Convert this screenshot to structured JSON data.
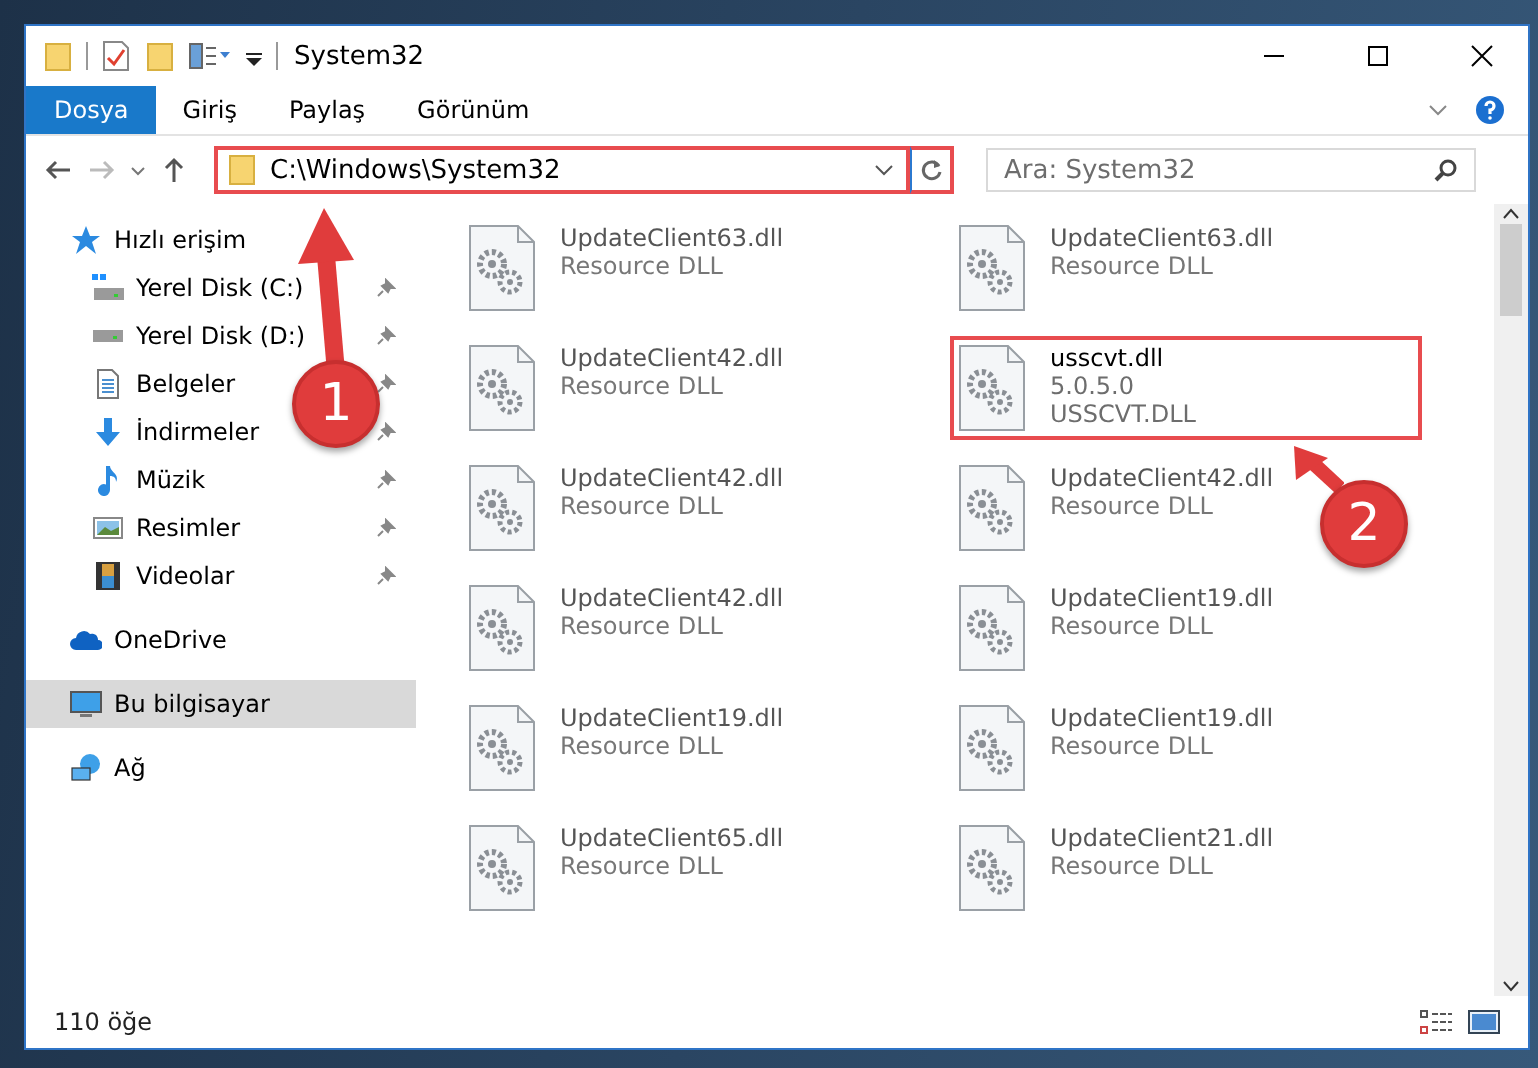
{
  "window": {
    "title": "System32"
  },
  "ribbon_tabs": [
    {
      "label": "Dosya",
      "selected": true
    },
    {
      "label": "Giriş",
      "selected": false
    },
    {
      "label": "Paylaş",
      "selected": false
    },
    {
      "label": "Görünüm",
      "selected": false
    }
  ],
  "address": {
    "value": "C:\\Windows\\System32",
    "highlighted": true
  },
  "search": {
    "placeholder": "Ara: System32"
  },
  "sidebar": [
    {
      "label": "Hızlı erişim",
      "kind": "star",
      "selected": false,
      "children": [
        {
          "label": "Yerel Disk (C:)",
          "kind": "system-drive",
          "pinned": true,
          "selected": false
        },
        {
          "label": "Yerel Disk (D:)",
          "kind": "drive",
          "pinned": true,
          "selected": false
        },
        {
          "label": "Belgeler",
          "kind": "document",
          "pinned": true,
          "selected": false
        },
        {
          "label": "İndirmeler",
          "kind": "download",
          "pinned": true,
          "selected": false
        },
        {
          "label": "Müzik",
          "kind": "music",
          "pinned": true,
          "selected": false
        },
        {
          "label": "Resimler",
          "kind": "pictures",
          "pinned": true,
          "selected": false
        },
        {
          "label": "Videolar",
          "kind": "video",
          "pinned": true,
          "selected": false
        }
      ]
    },
    {
      "label": "OneDrive",
      "kind": "cloud",
      "selected": false
    },
    {
      "label": "Bu bilgisayar",
      "kind": "computer",
      "selected": true
    },
    {
      "label": "Ağ",
      "kind": "network",
      "selected": false
    }
  ],
  "files": [
    {
      "name": "UpdateClient63.dll",
      "lines": [
        "Resource DLL"
      ],
      "blurred": true,
      "highlighted": false
    },
    {
      "name": "UpdateClient63.dll",
      "lines": [
        "Resource DLL"
      ],
      "blurred": true,
      "highlighted": false
    },
    {
      "name": "UpdateClient42.dll",
      "lines": [
        "Resource DLL"
      ],
      "blurred": true,
      "highlighted": false
    },
    {
      "name": "usscvt.dll",
      "lines": [
        "5.0.5.0",
        "USSCVT.DLL"
      ],
      "blurred": false,
      "highlighted": true
    },
    {
      "name": "UpdateClient42.dll",
      "lines": [
        "Resource DLL"
      ],
      "blurred": true,
      "highlighted": false
    },
    {
      "name": "UpdateClient42.dll",
      "lines": [
        "Resource DLL"
      ],
      "blurred": true,
      "highlighted": false
    },
    {
      "name": "UpdateClient42.dll",
      "lines": [
        "Resource DLL"
      ],
      "blurred": true,
      "highlighted": false
    },
    {
      "name": "UpdateClient19.dll",
      "lines": [
        "Resource DLL"
      ],
      "blurred": true,
      "highlighted": false
    },
    {
      "name": "UpdateClient19.dll",
      "lines": [
        "Resource DLL"
      ],
      "blurred": true,
      "highlighted": false
    },
    {
      "name": "UpdateClient19.dll",
      "lines": [
        "Resource DLL"
      ],
      "blurred": true,
      "highlighted": false
    },
    {
      "name": "UpdateClient65.dll",
      "lines": [
        "Resource DLL"
      ],
      "blurred": true,
      "highlighted": false
    },
    {
      "name": "UpdateClient21.dll",
      "lines": [
        "Resource DLL"
      ],
      "blurred": true,
      "highlighted": false
    }
  ],
  "status_bar": {
    "count": "110 öğe"
  },
  "annotations": [
    {
      "label": "1"
    },
    {
      "label": "2"
    }
  ]
}
